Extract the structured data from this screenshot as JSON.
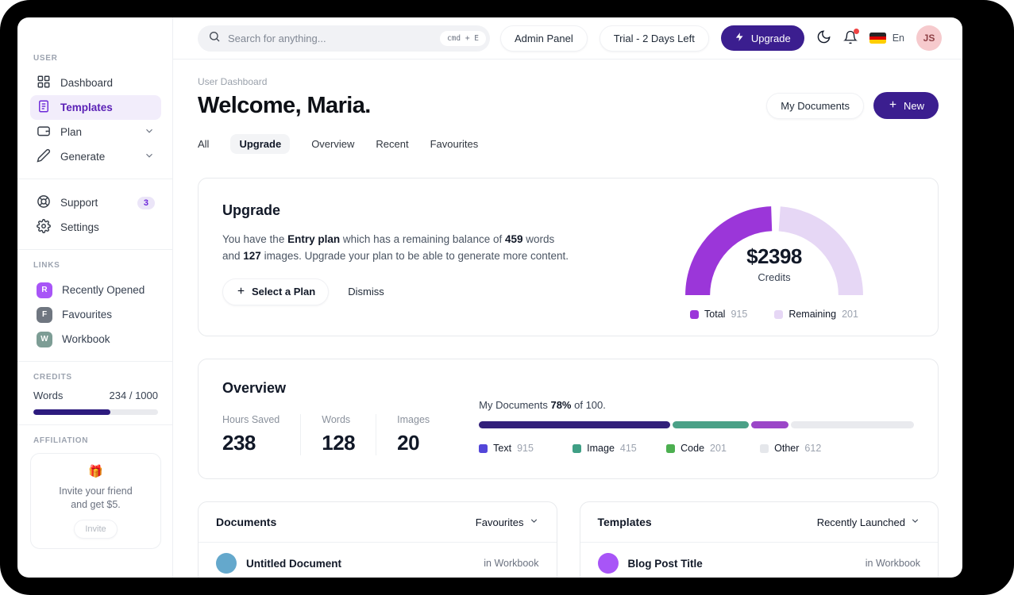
{
  "colors": {
    "accent_dark_purple": "#3b1e8f",
    "accent_purple": "#9b36d9",
    "active_item_bg": "#f2edfb",
    "active_item_text": "#5b21b6",
    "notification_dot": "#ef4444"
  },
  "topbar": {
    "search": {
      "placeholder": "Search for anything...",
      "shortcut": "cmd + E"
    },
    "admin_panel_button": "Admin Panel",
    "trial_button": "Trial - 2 Days Left",
    "upgrade_button": "Upgrade",
    "language": "En",
    "avatar_initials": "JS"
  },
  "sidebar": {
    "user_label": "USER",
    "items": [
      {
        "label": "Dashboard"
      },
      {
        "label": "Templates"
      },
      {
        "label": "Plan"
      },
      {
        "label": "Generate"
      }
    ],
    "support": {
      "label": "Support",
      "badge": "3"
    },
    "settings_label": "Settings",
    "links_label": "LINKS",
    "links": [
      {
        "initial": "R",
        "label": "Recently Opened",
        "color": "#a855f7"
      },
      {
        "initial": "F",
        "label": "Favourites",
        "color": "#6f7680"
      },
      {
        "initial": "W",
        "label": "Workbook",
        "color": "#7d9d95"
      }
    ],
    "credits_label": "CREDITS",
    "credits": {
      "label": "Words",
      "value": "234 / 1000",
      "fill_width": "62%"
    },
    "affiliation_label": "AFFILIATION",
    "invite": {
      "emoji": "🎁",
      "line1": "Invite your friend",
      "line2": "and get $5.",
      "button": "Invite"
    }
  },
  "header": {
    "breadcrumb": "User Dashboard",
    "title": "Welcome, Maria.",
    "my_documents_button": "My Documents",
    "new_button": "New"
  },
  "tabs": [
    {
      "label": "All"
    },
    {
      "label": "Upgrade",
      "active": true
    },
    {
      "label": "Overview"
    },
    {
      "label": "Recent"
    },
    {
      "label": "Favourites"
    }
  ],
  "upgrade_card": {
    "title": "Upgrade",
    "body": {
      "t1": "You have the ",
      "b1": "Entry plan",
      "t2": " which has a remaining balance of ",
      "b2": "459",
      "t3": " words and ",
      "b3": "127",
      "t4": " images. Upgrade your plan to be able to generate more content."
    },
    "select_plan_button": "Select a Plan",
    "dismiss_button": "Dismiss",
    "gauge": {
      "value": "$2398",
      "label": "Credits",
      "legend": [
        {
          "label": "Total",
          "value": "915",
          "color": "#9b36d9"
        },
        {
          "label": "Remaining",
          "value": "201",
          "color": "#e6d7f5"
        }
      ]
    }
  },
  "overview_card": {
    "title": "Overview",
    "stats": [
      {
        "label": "Hours Saved",
        "value": "238"
      },
      {
        "label": "Words",
        "value": "128"
      },
      {
        "label": "Images",
        "value": "20"
      }
    ],
    "progress": {
      "prefix": "My Documents ",
      "percent": "78%",
      "suffix": " of 100."
    },
    "bar": {
      "segments": [
        {
          "color": "#32207a",
          "width": "44%"
        },
        {
          "color": "#4aa187",
          "width": "17.5%"
        },
        {
          "color": "#9b46c8",
          "width": "8.5%"
        }
      ],
      "rest_color": "#e9eaee"
    },
    "legend": [
      {
        "label": "Text",
        "value": "915",
        "color": "#5346d9"
      },
      {
        "label": "Image",
        "value": "415",
        "color": "#3f9f85"
      },
      {
        "label": "Code",
        "value": "201",
        "color": "#4caf50"
      },
      {
        "label": "Other",
        "value": "612",
        "color": "#e5e7eb"
      }
    ]
  },
  "documents_card": {
    "title": "Documents",
    "filter": "Favourites",
    "rows": [
      {
        "name": "Untitled Document",
        "location": "in Workbook",
        "color": "#64a8cc"
      }
    ]
  },
  "templates_card": {
    "title": "Templates",
    "filter": "Recently Launched",
    "rows": [
      {
        "name": "Blog Post Title",
        "location": "in Workbook",
        "color": "#a855f7"
      }
    ]
  },
  "chart_data": [
    {
      "type": "pie",
      "subtype": "half-donut-gauge",
      "title": "Credits",
      "center_value": "$2398",
      "center_label": "Credits",
      "series": [
        {
          "name": "Total",
          "value": 915,
          "color": "#9b36d9"
        },
        {
          "name": "Remaining",
          "value": 201,
          "color": "#e6d7f5"
        }
      ],
      "legend_position": "bottom"
    },
    {
      "type": "bar",
      "subtype": "stacked-horizontal",
      "title": "My Documents 78% of 100.",
      "categories": [
        "Text",
        "Image",
        "Code",
        "Other"
      ],
      "values": [
        915,
        415,
        201,
        612
      ],
      "colors": [
        "#32207a",
        "#4aa187",
        "#9b46c8",
        "#e9eaee"
      ],
      "legend_position": "bottom"
    },
    {
      "type": "bar",
      "subtype": "progress",
      "title": "Words credits",
      "categories": [
        "Words"
      ],
      "values": [
        234
      ],
      "xlim": [
        0,
        1000
      ]
    }
  ]
}
